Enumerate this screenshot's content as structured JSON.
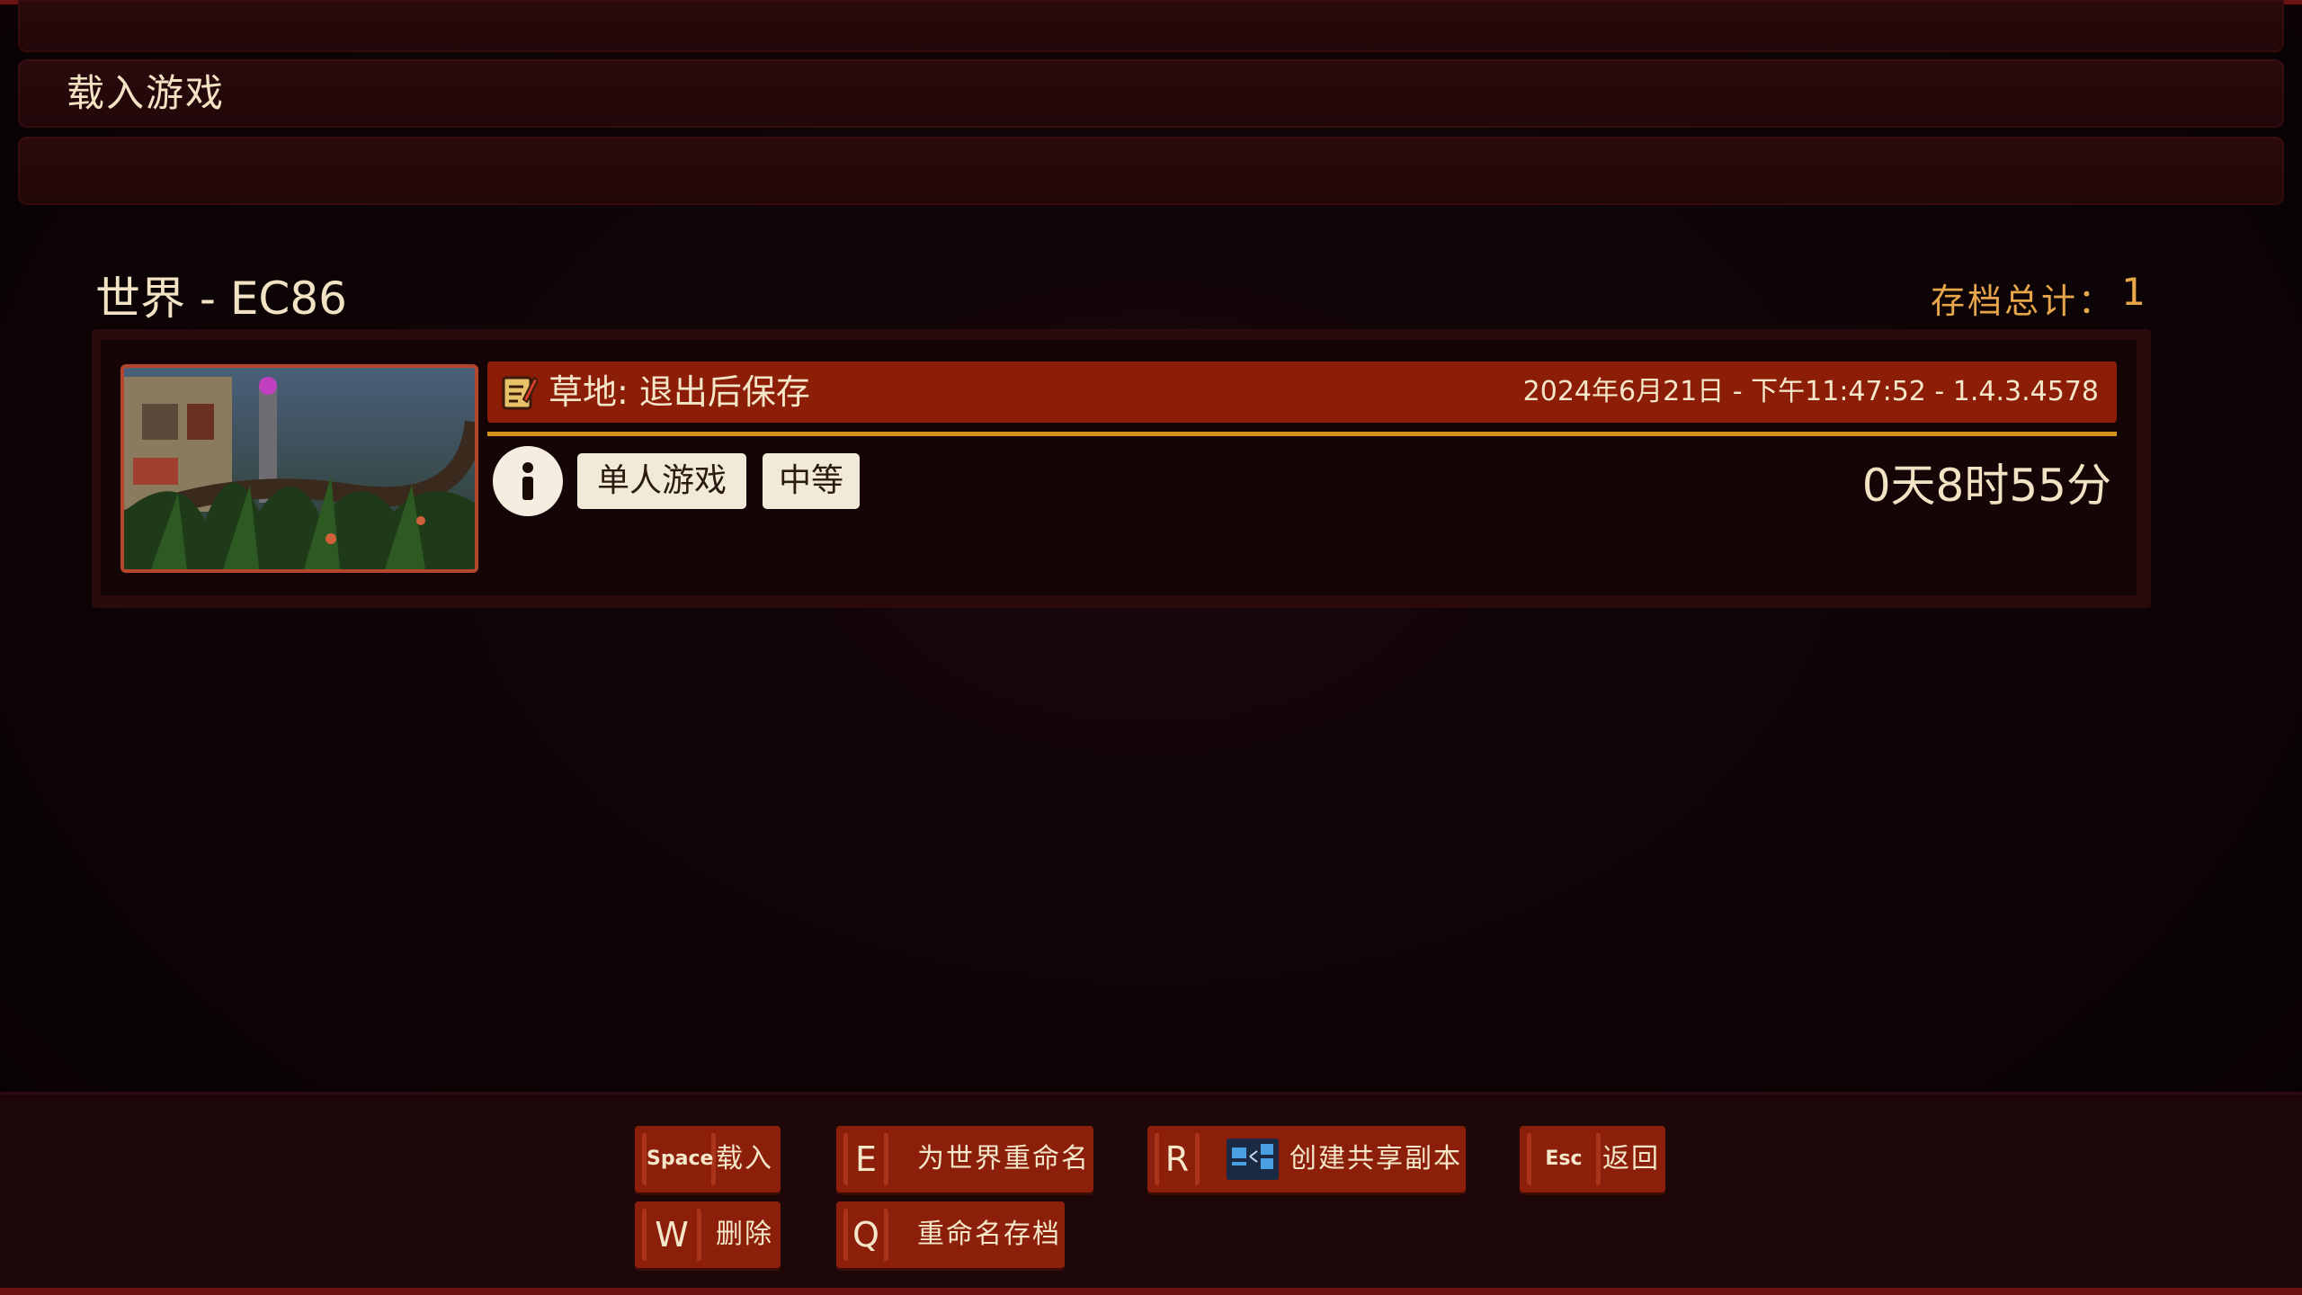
{
  "header": {
    "title": "载入游戏"
  },
  "world": {
    "title": "世界 - EC86",
    "save_count_label": "存档总计：",
    "save_count_value": "1"
  },
  "save": {
    "name": "草地: 退出后保存",
    "date_version": "2024年6月21日 - 下午11:47:52 - 1.4.3.4578",
    "mode": "单人游戏",
    "difficulty": "中等",
    "playtime": "0天8时55分"
  },
  "actions": {
    "load": {
      "key": "Space",
      "label": "载入"
    },
    "rename_world": {
      "key": "E",
      "label": "为世界重命名"
    },
    "share_copy": {
      "key": "R",
      "label": "创建共享副本"
    },
    "back": {
      "key": "Esc",
      "label": "返回"
    },
    "delete": {
      "key": "W",
      "label": "删除"
    },
    "rename_save": {
      "key": "Q",
      "label": "重命名存档"
    }
  },
  "colors": {
    "accent_red": "#8c1e08",
    "accent_gold": "#d4941c",
    "text_cream": "#f1e3c3",
    "text_orange": "#e8a64a"
  }
}
